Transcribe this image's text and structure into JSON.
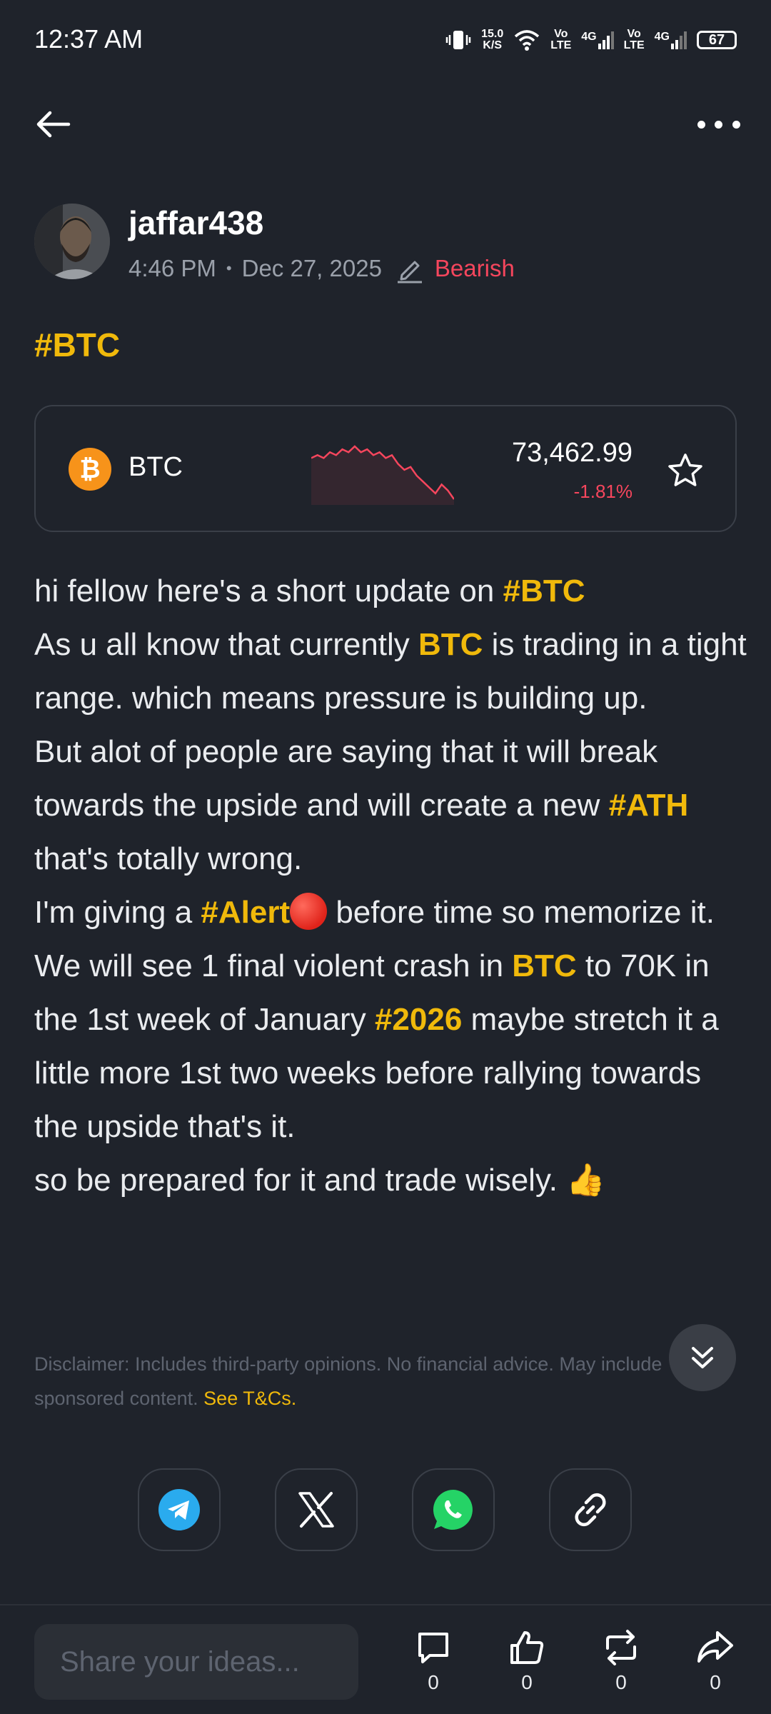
{
  "status_bar": {
    "time": "12:37 AM",
    "net_speed_top": "15.0",
    "net_speed_bottom": "K/S",
    "sim1_top": "Vo",
    "sim1_bottom": "LTE",
    "sim1_net": "4G",
    "sim2_top": "Vo",
    "sim2_bottom": "LTE",
    "sim2_net": "4G",
    "battery": "67"
  },
  "post": {
    "author": "jaffar438",
    "time": "4:46 PM",
    "separator": "•",
    "date": "Dec 27, 2025",
    "sentiment": "Bearish",
    "hashtag": "#BTC"
  },
  "coin_card": {
    "symbol": "BTC",
    "icon_letter": "₿",
    "price": "73,462.99",
    "change": "-1.81%",
    "sparkline": [
      8,
      7,
      8,
      6,
      7,
      5,
      6,
      4,
      6,
      5,
      7,
      6,
      8,
      7,
      10,
      12,
      11,
      14,
      16,
      18,
      20,
      17,
      19,
      22
    ]
  },
  "body": {
    "l1a": "hi fellow here's a short update on ",
    "l1b": "#BTC",
    "l2a": "As u all know that currently ",
    "l2b": "BTC",
    "l2c": " is trading in a tight range. which means pressure is building up.",
    "l3a": "But alot of people are saying that it will break towards the upside and will create a new ",
    "l3b": "#ATH",
    "l3c": "  that's totally wrong.",
    "l4a": "I'm giving a ",
    "l4b": "#Alert",
    "l4c": " before time so memorize it.",
    "l5a": "We will see 1 final violent crash in ",
    "l5b": "BTC",
    "l5c": " to 70K in the 1st week of January ",
    "l5d": "#2026",
    "l5e": " maybe stretch it a little more 1st two weeks before rallying towards the upside that's it.",
    "l6a": "so be prepared for it and trade wisely. ",
    "l6b": "👍"
  },
  "disclaimer": {
    "text": "Disclaimer: Includes third-party opinions. No financial advice. May include sponsored content. ",
    "link": "See T&Cs."
  },
  "share_row": [
    "telegram-icon",
    "x-icon",
    "whatsapp-icon",
    "link-icon"
  ],
  "bottom_bar": {
    "input_placeholder": "Share your ideas...",
    "comment_count": "0",
    "like_count": "0",
    "repost_count": "0",
    "share_count": "0"
  },
  "colors": {
    "background": "#1f232b",
    "accent": "#f0b90b",
    "bearish": "#f6465d",
    "btc_orange": "#f7931a",
    "telegram": "#2aabee",
    "whatsapp": "#25d366"
  }
}
